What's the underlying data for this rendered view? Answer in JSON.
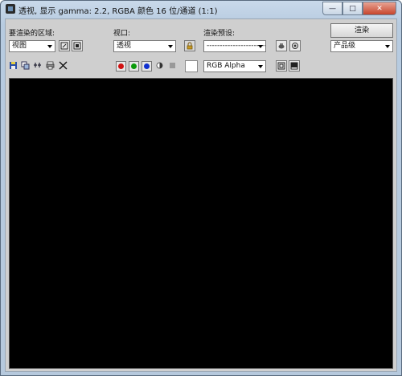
{
  "window": {
    "title": "透视, 显示 gamma: 2.2, RGBA 颜色 16 位/通道 (1:1)",
    "minimize_label": "—",
    "maximize_label": "□",
    "close_label": "✕"
  },
  "area": {
    "label": "要渲染的区域:",
    "value": "视图"
  },
  "viewport_sel": {
    "label": "视口:",
    "value": "透视"
  },
  "preset": {
    "label": "渲染预设:",
    "value": "-------------------------"
  },
  "render": {
    "button_label": "渲染",
    "quality_value": "产品级"
  },
  "channel": {
    "value": "RGB Alpha"
  },
  "colors": {
    "red": "#d01010",
    "green": "#0a9a0a",
    "blue": "#1030d0",
    "viewport_bg": "#000000"
  }
}
